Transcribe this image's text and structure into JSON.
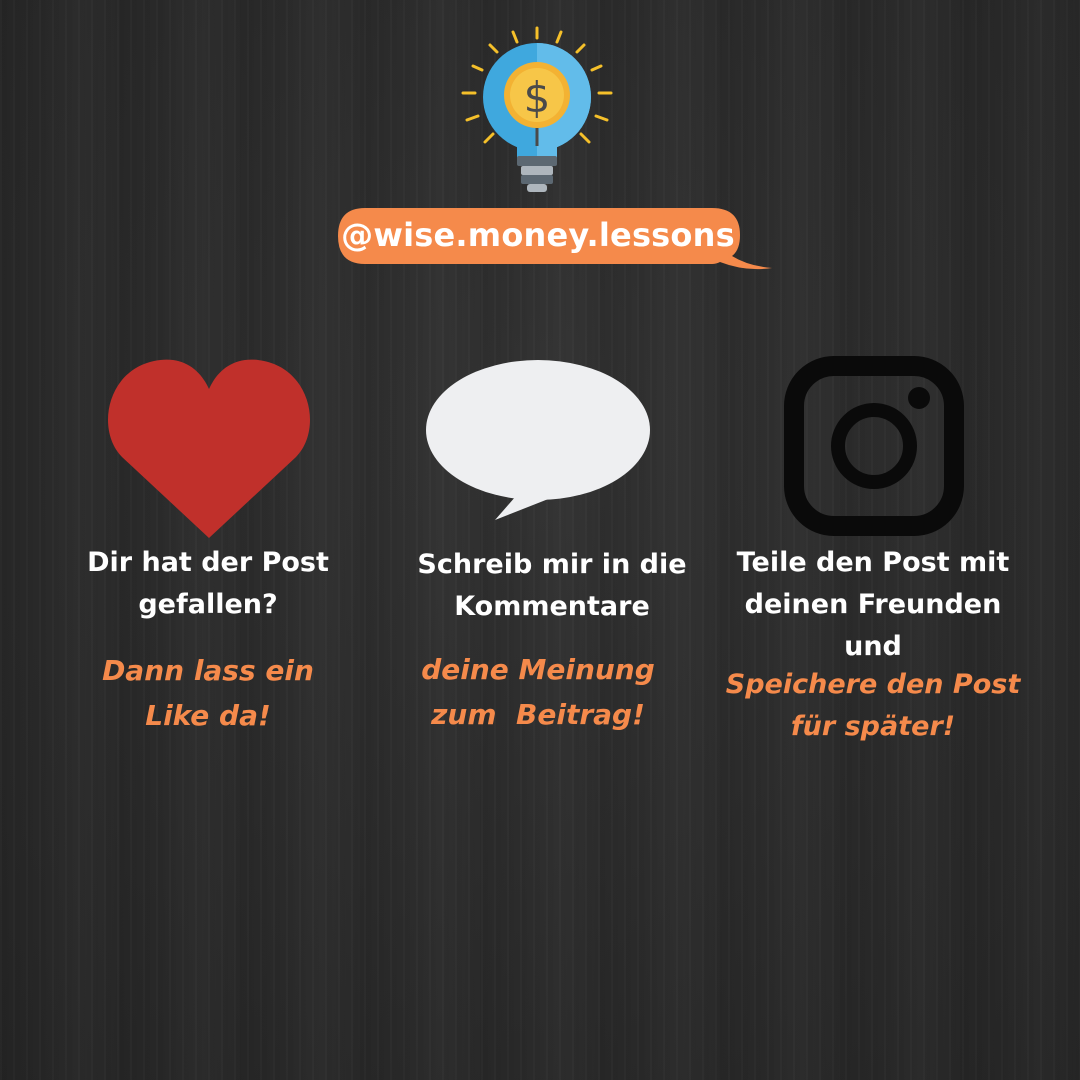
{
  "header": {
    "handle": "@wise.money.lessons",
    "bulb_symbol": "$",
    "bubble_color": "#f58a4b"
  },
  "columns": [
    {
      "icon": "heart-icon",
      "icon_color": "#c0302b",
      "line1": "Dir hat der Post",
      "line2": "gefallen?",
      "cta_line1": "Dann lass ein",
      "cta_line2": "Like da!"
    },
    {
      "icon": "comment-icon",
      "icon_color": "#eeeff1",
      "line1": "Schreib mir in die",
      "line2": "Kommentare",
      "cta_line1": "deine Meinung",
      "cta_line2": "zum  Beitrag!"
    },
    {
      "icon": "instagram-icon",
      "icon_color": "#0a0a0a",
      "line1": "Teile den Post mit",
      "line2": "deinen Freunden",
      "line3": "und",
      "cta_line1": "Speichere den Post",
      "cta_line2": "für später!"
    }
  ],
  "colors": {
    "background": "#2b2b2b",
    "accent": "#f58a4b",
    "text": "#ffffff"
  }
}
